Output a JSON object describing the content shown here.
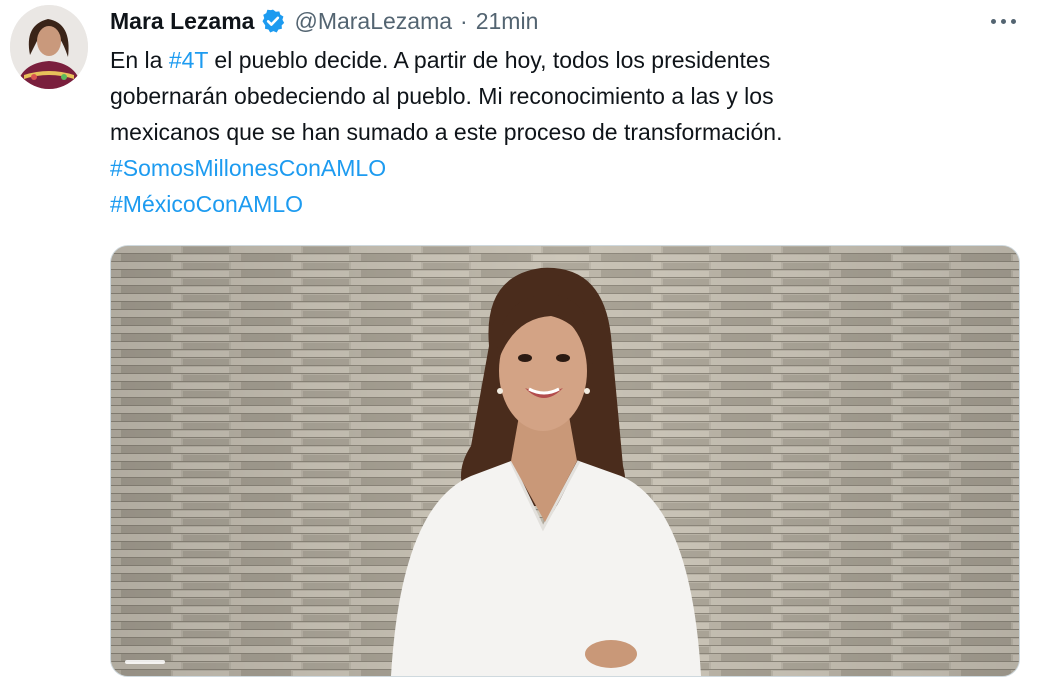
{
  "tweet": {
    "author_name": "Mara Lezama",
    "handle": "@MaraLezama",
    "separator": "·",
    "time": "21min",
    "lines": [
      [
        {
          "t": "En la ",
          "tag": false
        },
        {
          "t": "#4T",
          "tag": true
        },
        {
          "t": " el pueblo decide. A partir de hoy, todos los presidentes",
          "tag": false
        }
      ],
      [
        {
          "t": "gobernarán obedeciendo al pueblo. Mi reconocimiento a las y los",
          "tag": false
        }
      ],
      [
        {
          "t": "mexicanos que se han sumado a este proceso de transformación.",
          "tag": false
        }
      ],
      [
        {
          "t": "#SomosMillonesConAMLO",
          "tag": true
        }
      ],
      [
        {
          "t": "#MéxicoConAMLO",
          "tag": true
        }
      ]
    ]
  },
  "icons": {
    "verified": "verified-badge-icon",
    "more": "more-options-icon"
  },
  "colors": {
    "text": "#0f1419",
    "secondary": "#536471",
    "link": "#1d9bf0",
    "verified": "#1d9bf0"
  }
}
